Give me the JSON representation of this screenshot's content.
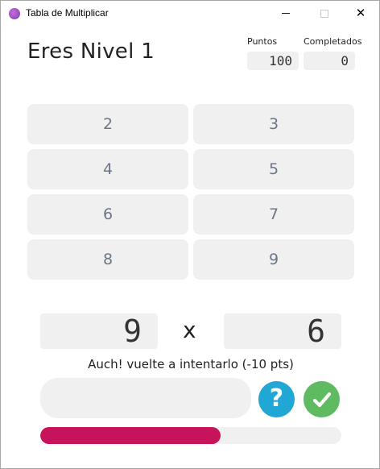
{
  "window": {
    "title": "Tabla de Multiplicar",
    "close_glyph": "✕"
  },
  "header": {
    "level_title": "Eres Nivel 1",
    "points_label": "Puntos",
    "points_value": "100",
    "completed_label": "Completados",
    "completed_value": "0"
  },
  "tables": [
    {
      "label": "2"
    },
    {
      "label": "3"
    },
    {
      "label": "4"
    },
    {
      "label": "5"
    },
    {
      "label": "6"
    },
    {
      "label": "7"
    },
    {
      "label": "8"
    },
    {
      "label": "9"
    }
  ],
  "question": {
    "left": "9",
    "operator": "x",
    "right": "6"
  },
  "message": "Auch! vuelte a intentarlo (-10 pts)",
  "answer": {
    "value": "",
    "placeholder": ""
  },
  "buttons": {
    "help_glyph": "?",
    "help_icon": "question-icon",
    "check_icon": "check-icon"
  },
  "progress": {
    "fraction": 0.6,
    "color": "#c7125c"
  },
  "colors": {
    "help": "#20a7d6",
    "check": "#5fbb60",
    "tile_bg": "#f0f0f0",
    "tile_text": "#6d7686"
  }
}
